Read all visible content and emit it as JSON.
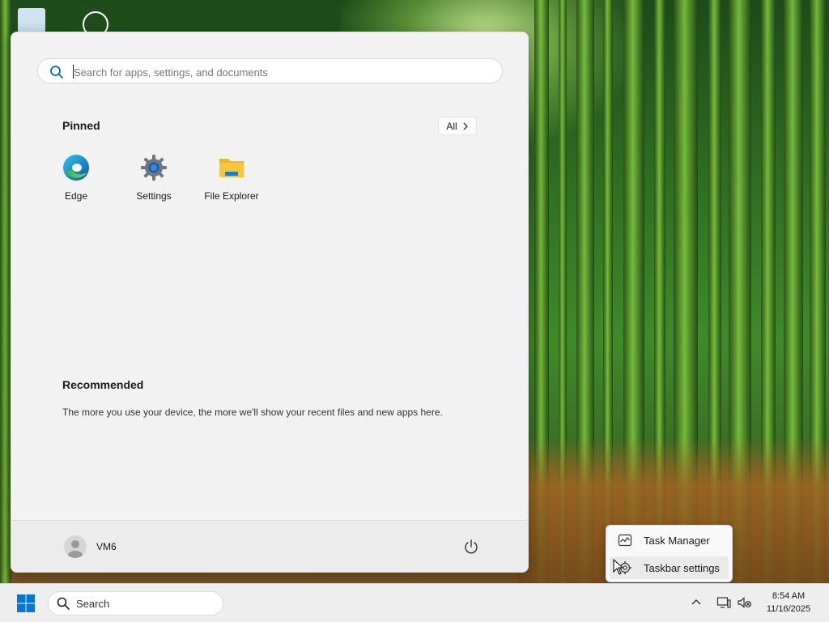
{
  "start_menu": {
    "search": {
      "placeholder": "Search for apps, settings, and documents"
    },
    "pinned": {
      "title": "Pinned",
      "all_label": "All",
      "apps": [
        {
          "label": "Edge",
          "icon": "edge-icon"
        },
        {
          "label": "Settings",
          "icon": "gear-icon"
        },
        {
          "label": "File Explorer",
          "icon": "folder-icon"
        }
      ]
    },
    "recommended": {
      "title": "Recommended",
      "text": "The more you use your device, the more we'll show your recent files and new apps here."
    },
    "user": {
      "name": "VM6"
    }
  },
  "context_menu": {
    "items": [
      {
        "label": "Task Manager",
        "icon": "task-manager-icon"
      },
      {
        "label": "Taskbar settings",
        "icon": "gear-icon"
      }
    ]
  },
  "taskbar": {
    "search_label": "Search",
    "clock": {
      "time": "8:54 AM",
      "date": "11/16/2025"
    }
  },
  "colors": {
    "accent": "#0067c0",
    "windows_logo": "#0078d4",
    "folder": "#f8c63a"
  }
}
